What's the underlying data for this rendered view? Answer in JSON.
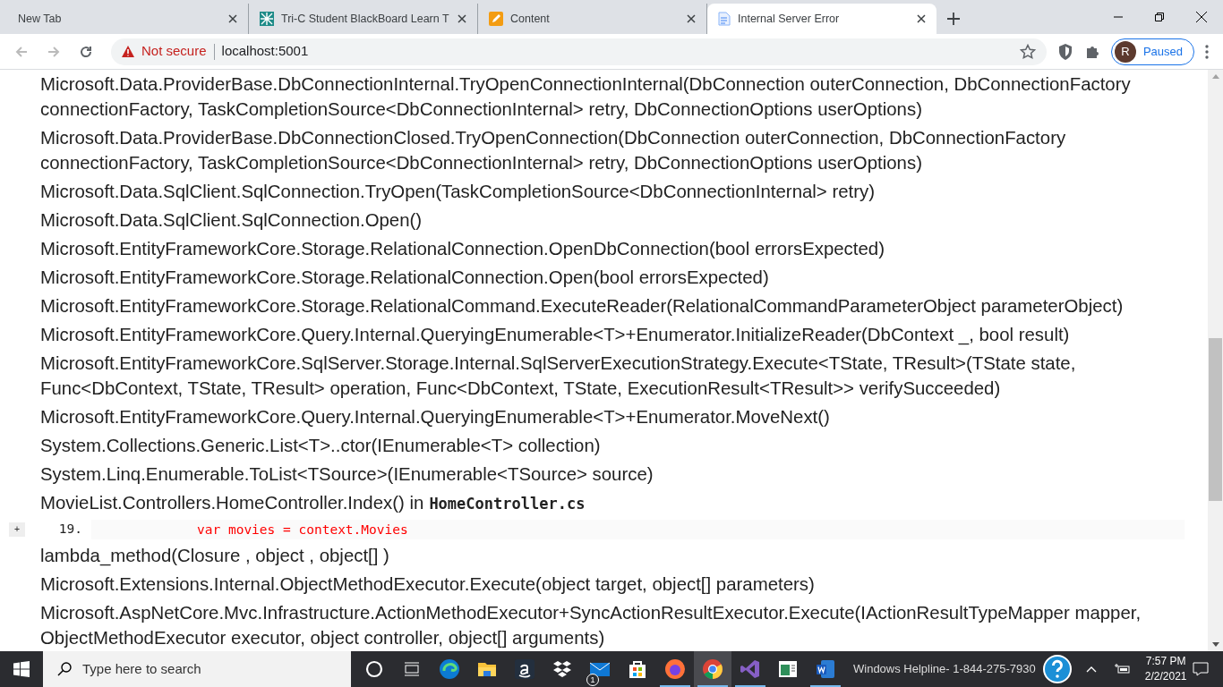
{
  "tabs": [
    {
      "title": "New Tab",
      "kind": "blank",
      "selected": false
    },
    {
      "title": "Tri-C Student BlackBoard Learn T",
      "kind": "pattern",
      "selected": false
    },
    {
      "title": "Content",
      "kind": "pencil",
      "selected": false
    },
    {
      "title": "Internal Server Error",
      "kind": "page",
      "selected": true
    }
  ],
  "address_bar": {
    "security": "Not secure",
    "url": "localhost:5001"
  },
  "profile": {
    "initial": "R",
    "status": "Paused"
  },
  "stack": [
    {
      "kind": "frame",
      "text": "Microsoft.Data.ProviderBase.DbConnectionInternal.TryOpenConnectionInternal(DbConnection outerConnection, DbConnectionFactory connectionFactory, TaskCompletionSource<DbConnectionInternal> retry, DbConnectionOptions userOptions)"
    },
    {
      "kind": "frame",
      "text": "Microsoft.Data.ProviderBase.DbConnectionClosed.TryOpenConnection(DbConnection outerConnection, DbConnectionFactory connectionFactory, TaskCompletionSource<DbConnectionInternal> retry, DbConnectionOptions userOptions)"
    },
    {
      "kind": "frame",
      "text": "Microsoft.Data.SqlClient.SqlConnection.TryOpen(TaskCompletionSource<DbConnectionInternal> retry)"
    },
    {
      "kind": "frame",
      "text": "Microsoft.Data.SqlClient.SqlConnection.Open()"
    },
    {
      "kind": "frame",
      "text": "Microsoft.EntityFrameworkCore.Storage.RelationalConnection.OpenDbConnection(bool errorsExpected)"
    },
    {
      "kind": "frame",
      "text": "Microsoft.EntityFrameworkCore.Storage.RelationalConnection.Open(bool errorsExpected)"
    },
    {
      "kind": "frame",
      "text": "Microsoft.EntityFrameworkCore.Storage.RelationalCommand.ExecuteReader(RelationalCommandParameterObject parameterObject)"
    },
    {
      "kind": "frame",
      "text": "Microsoft.EntityFrameworkCore.Query.Internal.QueryingEnumerable<T>+Enumerator.InitializeReader(DbContext _, bool result)"
    },
    {
      "kind": "frame",
      "text": "Microsoft.EntityFrameworkCore.SqlServer.Storage.Internal.SqlServerExecutionStrategy.Execute<TState, TResult>(TState state, Func<DbContext, TState, TResult> operation, Func<DbContext, TState, ExecutionResult<TResult>> verifySucceeded)"
    },
    {
      "kind": "frame",
      "text": "Microsoft.EntityFrameworkCore.Query.Internal.QueryingEnumerable<T>+Enumerator.MoveNext()"
    },
    {
      "kind": "frame",
      "text": "System.Collections.Generic.List<T>..ctor(IEnumerable<T> collection)"
    },
    {
      "kind": "frame",
      "text": "System.Linq.Enumerable.ToList<TSource>(IEnumerable<TSource> source)"
    },
    {
      "kind": "frame",
      "text": "MovieList.Controllers.HomeController.Index() in",
      "file": "HomeController.cs"
    },
    {
      "kind": "code",
      "toggle": "+",
      "line_number": "19.",
      "code": "var movies = context.Movies"
    },
    {
      "kind": "frame",
      "text": "lambda_method(Closure , object , object[] )"
    },
    {
      "kind": "frame",
      "text": "Microsoft.Extensions.Internal.ObjectMethodExecutor.Execute(object target, object[] parameters)"
    },
    {
      "kind": "frame",
      "text": "Microsoft.AspNetCore.Mvc.Infrastructure.ActionMethodExecutor+SyncActionResultExecutor.Execute(IActionResultTypeMapper mapper, ObjectMethodExecutor executor, object controller, object[] arguments)"
    }
  ],
  "taskbar": {
    "search_placeholder": "Type here to search",
    "apps": [
      {
        "kind": "cortana",
        "open": false,
        "selected": false
      },
      {
        "kind": "taskview",
        "open": false,
        "selected": false
      },
      {
        "kind": "edge",
        "open": false,
        "selected": false
      },
      {
        "kind": "folder",
        "open": false,
        "selected": false
      },
      {
        "kind": "amazon",
        "open": false,
        "selected": false
      },
      {
        "kind": "dropbox",
        "open": false,
        "selected": false
      },
      {
        "kind": "mail",
        "open": false,
        "selected": false,
        "badge": "1"
      },
      {
        "kind": "store",
        "open": false,
        "selected": false
      },
      {
        "kind": "firefox",
        "open": true,
        "selected": false
      },
      {
        "kind": "chrome",
        "open": true,
        "selected": true
      },
      {
        "kind": "vs",
        "open": true,
        "selected": false
      },
      {
        "kind": "window",
        "open": false,
        "selected": false
      },
      {
        "kind": "word",
        "open": true,
        "selected": false
      }
    ],
    "helpline": "Windows Helpline- 1-844-275-7930",
    "time": "7:57 PM",
    "date": "2/2/2021"
  }
}
